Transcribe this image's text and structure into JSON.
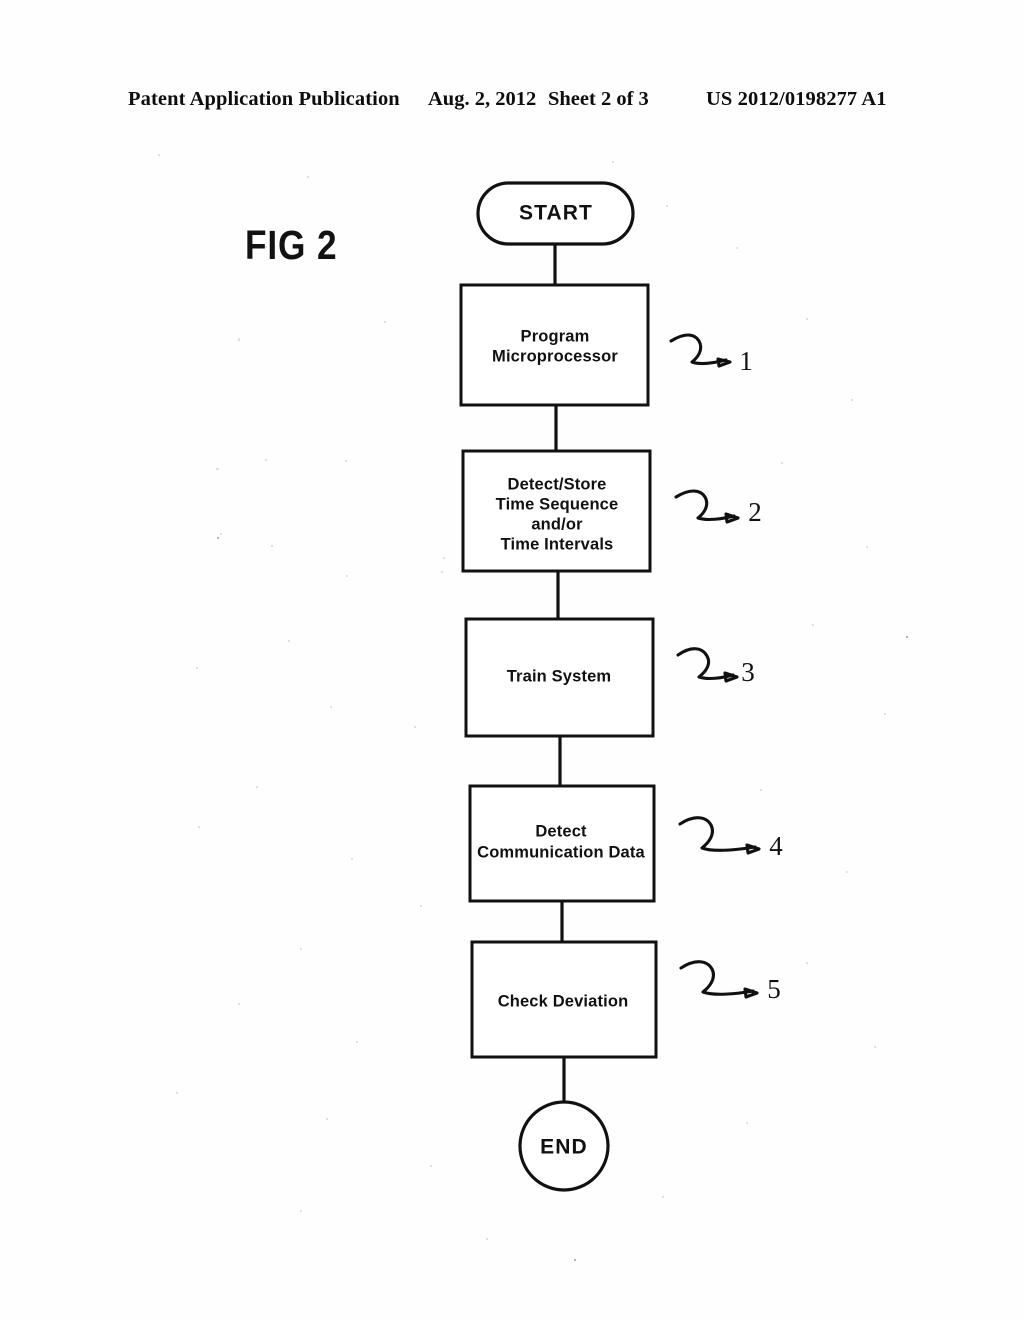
{
  "header": {
    "publication": "Patent Application Publication",
    "date": "Aug. 2, 2012",
    "sheet": "Sheet 2 of 3",
    "patent_number": "US 2012/0198277 A1"
  },
  "figure": {
    "label": "FIG 2"
  },
  "chart_data": {
    "type": "diagram",
    "diagram_type": "flowchart",
    "title": "FIG 2",
    "orientation": "vertical",
    "nodes": [
      {
        "id": "start",
        "shape": "stadium",
        "label": "START",
        "ref": null
      },
      {
        "id": "step1",
        "shape": "rect",
        "label": "Program\nMicroprocessor",
        "ref": "1"
      },
      {
        "id": "step2",
        "shape": "rect",
        "label": "Detect/Store\nTime Sequence\nand/or\nTime Intervals",
        "ref": "2"
      },
      {
        "id": "step3",
        "shape": "rect",
        "label": "Train System",
        "ref": "3"
      },
      {
        "id": "step4",
        "shape": "rect",
        "label": "Detect\nCommunication Data",
        "ref": "4"
      },
      {
        "id": "step5",
        "shape": "rect",
        "label": "Check Deviation",
        "ref": "5"
      },
      {
        "id": "end",
        "shape": "circle",
        "label": "END",
        "ref": null
      }
    ],
    "edges": [
      {
        "from": "start",
        "to": "step1"
      },
      {
        "from": "step1",
        "to": "step2"
      },
      {
        "from": "step2",
        "to": "step3"
      },
      {
        "from": "step3",
        "to": "step4"
      },
      {
        "from": "step4",
        "to": "step5"
      },
      {
        "from": "step5",
        "to": "end"
      }
    ],
    "reference_numerals": [
      "1",
      "2",
      "3",
      "4",
      "5"
    ]
  },
  "nodes": {
    "start": {
      "label": "START"
    },
    "step1": {
      "line1": "Program",
      "line2": "Microprocessor",
      "ref": "1"
    },
    "step2": {
      "line1": "Detect/Store",
      "line2": "Time Sequence",
      "line3": "and/or",
      "line4": "Time Intervals",
      "ref": "2"
    },
    "step3": {
      "line1": "Train System",
      "ref": "3"
    },
    "step4": {
      "line1": "Detect",
      "line2": "Communication Data",
      "ref": "4"
    },
    "step5": {
      "line1": "Check Deviation",
      "ref": "5"
    },
    "end": {
      "label": "END"
    }
  },
  "colors": {
    "ink": "#111111",
    "paper": "#fefefe"
  }
}
